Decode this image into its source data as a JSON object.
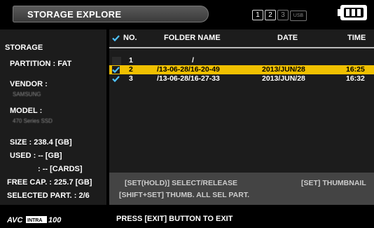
{
  "header": {
    "title": "STORAGE EXPLORE",
    "slots": [
      "1",
      "2",
      "3",
      "USB"
    ]
  },
  "left_panel": {
    "storage_label": "STORAGE",
    "partition": "PARTITION : FAT",
    "vendor_label": "VENDOR :",
    "vendor_value": "SAMSUNG",
    "model_label": "MODEL :",
    "model_value": "470 Series SSD",
    "size": "SIZE : 238.4 [GB]",
    "used": "USED : -- [GB]",
    "cards": ": -- [CARDS]",
    "free_cap": "FREE CAP. : 225.7 [GB]",
    "selected_part": "SELECTED PART. : 2/6"
  },
  "table": {
    "headers": {
      "no": "NO.",
      "folder": "FOLDER NAME",
      "date": "DATE",
      "time": "TIME"
    },
    "rows": [
      {
        "checked": false,
        "no": "1",
        "folder": "/",
        "date": "",
        "time": "",
        "selected": false
      },
      {
        "checked": true,
        "no": "2",
        "folder": "/13-06-28/16-20-49",
        "date": "2013/JUN/28",
        "time": "16:25",
        "selected": true
      },
      {
        "checked": true,
        "no": "3",
        "folder": "/13-06-28/16-27-33",
        "date": "2013/JUN/28",
        "time": "16:32",
        "selected": false
      }
    ]
  },
  "help": {
    "line1_left": "[SET(HOLD)] SELECT/RELEASE",
    "line1_right": "[SET] THUMBNAIL",
    "line2": "[SHIFT+SET] THUMB. ALL SEL PART."
  },
  "footer": {
    "logo_text": "AVC INTRA 100",
    "message": "PRESS [EXIT] BUTTON TO EXIT"
  },
  "colors": {
    "selection": "#f0c000",
    "check": "#4fc3ff"
  }
}
